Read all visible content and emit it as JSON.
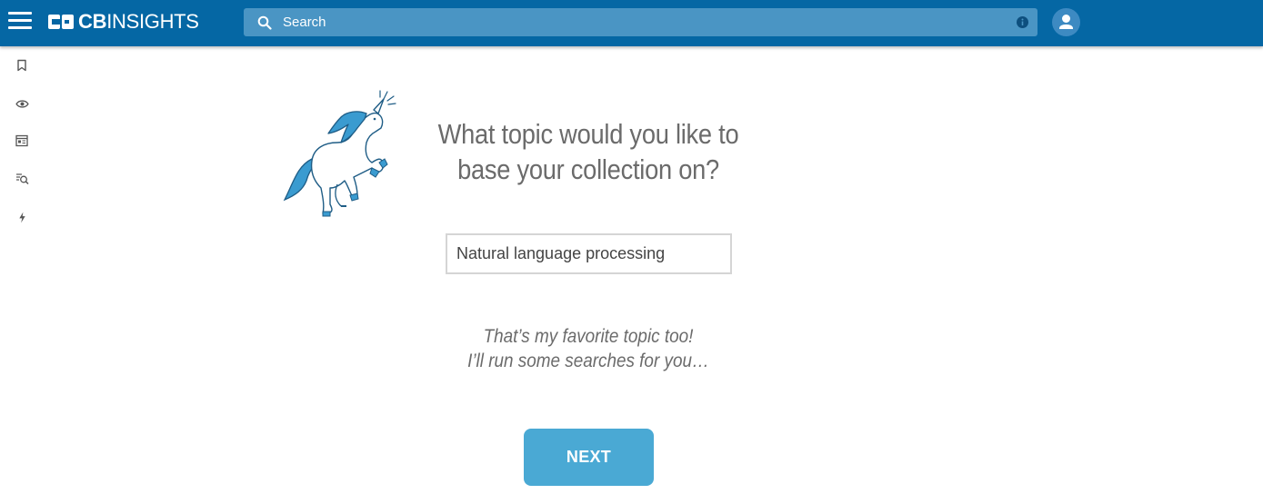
{
  "header": {
    "logo_bold": "CB",
    "logo_light": "INSIGHTS",
    "search_placeholder": "Search",
    "menu_icon": "hamburger-menu-icon",
    "search_icon": "search-icon",
    "info_icon": "info-icon",
    "avatar_icon": "user-avatar-icon"
  },
  "sidebar": {
    "items": [
      {
        "icon": "bookmark-icon"
      },
      {
        "icon": "eye-icon"
      },
      {
        "icon": "news-feed-icon"
      },
      {
        "icon": "search-list-icon"
      },
      {
        "icon": "lightning-icon"
      }
    ]
  },
  "main": {
    "question_line1": "What topic would you like to",
    "question_line2": "base your collection on?",
    "topic_value": "Natural language processing",
    "reply_line1": "That’s my favorite topic too!",
    "reply_line2": "I’ll run some searches for you…",
    "next_label": "NEXT",
    "illustration": "unicorn-illustration"
  },
  "colors": {
    "header_bg": "#0567a4",
    "search_bg": "#4a95c4",
    "accent": "#4aa9d4",
    "text_muted": "#6b6b6b"
  }
}
